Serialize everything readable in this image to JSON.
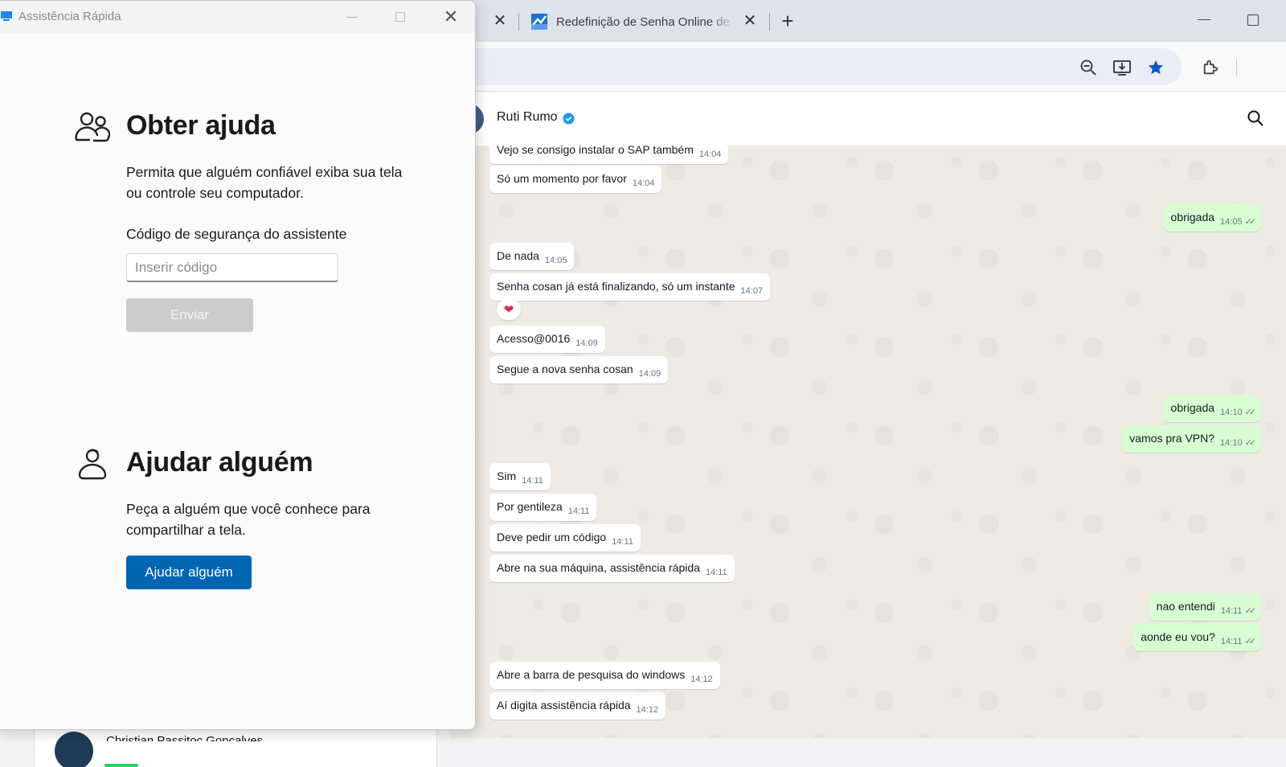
{
  "browser": {
    "active_tab_title": "Redefinição de Senha Online de",
    "close_symbol": "✕",
    "new_tab_symbol": "+",
    "toolbar_icons": [
      "zoom-out-icon",
      "install-app-icon",
      "bookmark-star-icon",
      "extensions-icon"
    ],
    "accent_color": "#0b57d0"
  },
  "whatsapp": {
    "contact_name": "Ruti Rumo",
    "tick_symbol": "✓✓",
    "reaction": "❤",
    "messages": [
      {
        "dir": "in",
        "text": "Vejo se consigo instalar o SAP também",
        "time": "14:04"
      },
      {
        "dir": "in",
        "text": "Só um momento por favor",
        "time": "14:04"
      },
      {
        "dir": "out",
        "text": "obrigada",
        "time": "14:05"
      },
      {
        "dir": "in",
        "text": "De nada",
        "time": "14:05"
      },
      {
        "dir": "in",
        "text": "Senha cosan já está finalizando, só um instante",
        "time": "14:07"
      },
      {
        "dir": "in",
        "text": "Acesso@0016",
        "time": "14:09"
      },
      {
        "dir": "in",
        "text": "Segue a nova senha cosan",
        "time": "14:09"
      },
      {
        "dir": "out",
        "text": "obrigada",
        "time": "14:10"
      },
      {
        "dir": "out",
        "text": "vamos pra VPN?",
        "time": "14:10"
      },
      {
        "dir": "in",
        "text": "Sim",
        "time": "14:11"
      },
      {
        "dir": "in",
        "text": "Por gentileza",
        "time": "14:11"
      },
      {
        "dir": "in",
        "text": "Deve pedir um código",
        "time": "14:11"
      },
      {
        "dir": "in",
        "text": "Abre na sua máquina, assistência rápida",
        "time": "14:11"
      },
      {
        "dir": "out",
        "text": "nao entendi",
        "time": "14:11"
      },
      {
        "dir": "out",
        "text": "aonde eu vou?",
        "time": "14:11"
      },
      {
        "dir": "in",
        "text": "Abre a barra de pesquisa do windows",
        "time": "14:12"
      },
      {
        "dir": "in",
        "text": "Aí digita assistência rápida",
        "time": "14:12"
      }
    ],
    "bubble_colors": {
      "in": "#ffffff",
      "out": "#d9fdd3"
    }
  },
  "quick_assist": {
    "window_title": "Assistência Rápida",
    "close_symbol": "✕",
    "get_help": {
      "heading": "Obter ajuda",
      "description": "Permita que alguém confiável exiba sua tela ou controle seu computador.",
      "code_label": "Código de segurança do assistente",
      "code_placeholder": "Inserir código",
      "submit_label": "Enviar"
    },
    "help_someone": {
      "heading": "Ajudar alguém",
      "description": "Peça a alguém que você conhece para compartilhar a tela.",
      "button_label": "Ajudar alguém"
    },
    "primary_color": "#0065b3"
  },
  "background_window": {
    "contact_name": "Christian Passitoc Gonçalves"
  }
}
